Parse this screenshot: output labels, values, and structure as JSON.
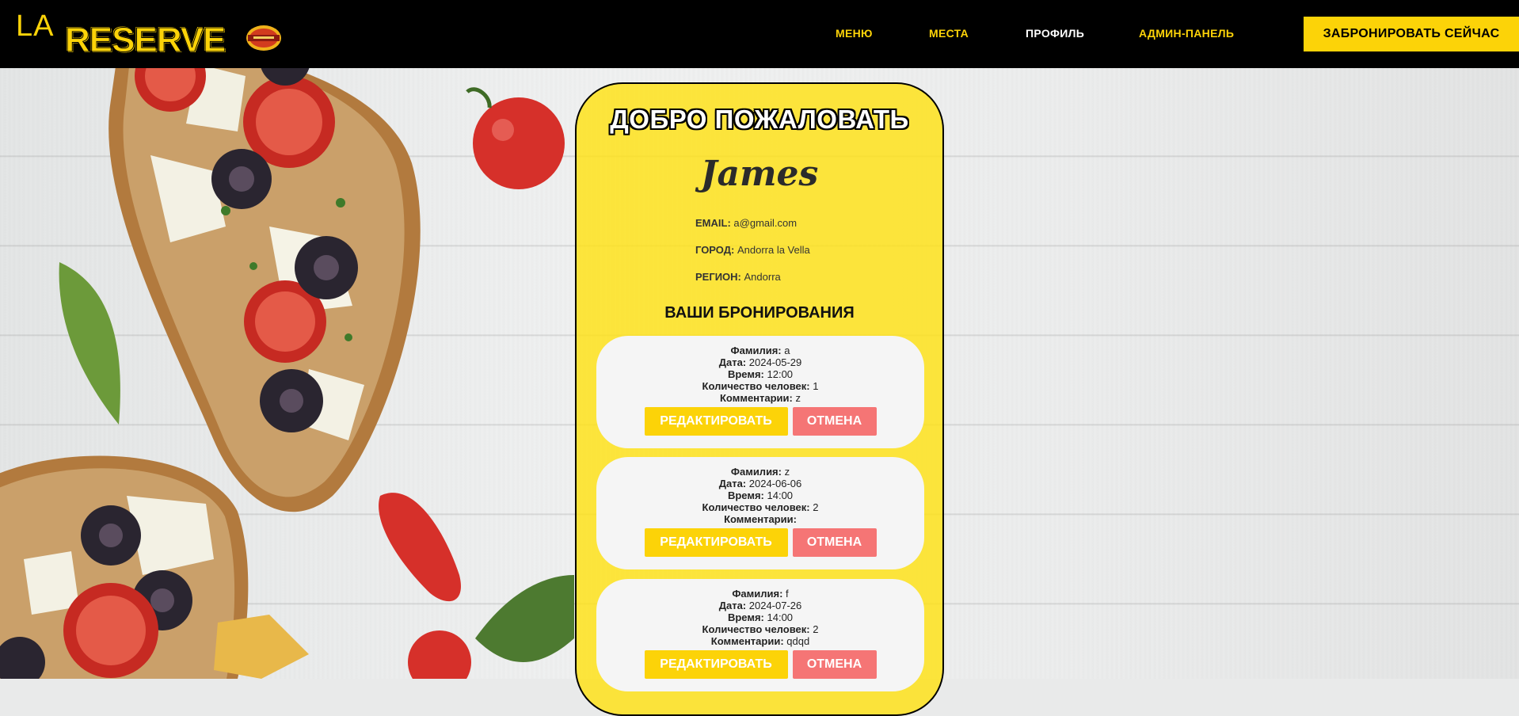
{
  "brand": {
    "word1": "LA",
    "word2": "RESERVE",
    "color": "#fcd308"
  },
  "nav": [
    {
      "label": "МЕНЮ",
      "active": false
    },
    {
      "label": "МЕСТА",
      "active": false
    },
    {
      "label": "ПРОФИЛЬ",
      "active": true
    },
    {
      "label": "АДМИН-ПАНЕЛЬ",
      "active": false
    }
  ],
  "header": {
    "book_label": "ЗАБРОНИРОВАТЬ СЕЙЧАС"
  },
  "profile": {
    "welcome": "ДОБРО ПОЖАЛОВАТЬ",
    "name": "James",
    "email_label": "EMAIL:",
    "email": "a@gmail.com",
    "city_label": "ГОРОД:",
    "city": "Andorra la Vella",
    "region_label": "РЕГИОН:",
    "region": "Andorra"
  },
  "bookings_title": "ВАШИ БРОНИРОВАНИЯ",
  "labels": {
    "surname": "Фамилия:",
    "date": "Дата:",
    "time": "Время:",
    "people": "Количество человек:",
    "comments": "Комментарии:",
    "edit": "РЕДАКТИРОВАТЬ",
    "cancel": "ОТМЕНА"
  },
  "bookings": [
    {
      "surname": "a",
      "date": "2024-05-29",
      "time": "12:00",
      "people": "1",
      "comments": "z"
    },
    {
      "surname": "z",
      "date": "2024-06-06",
      "time": "14:00",
      "people": "2",
      "comments": ""
    },
    {
      "surname": "f",
      "date": "2024-07-26",
      "time": "14:00",
      "people": "2",
      "comments": "qdqd"
    }
  ],
  "colors": {
    "accent": "#fcd308",
    "cancel": "#f57575",
    "header_bg": "#000000"
  }
}
